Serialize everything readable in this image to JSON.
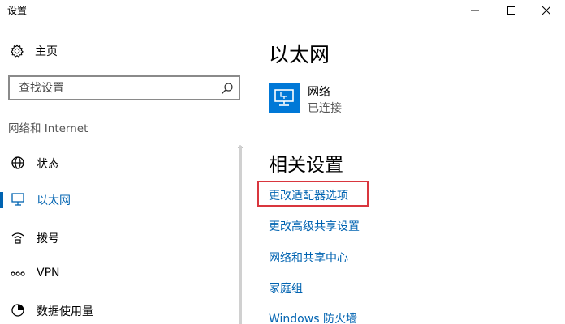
{
  "window": {
    "title": "设置",
    "controls": [
      "minimize-icon",
      "maximize-icon",
      "close-icon"
    ]
  },
  "sidebar": {
    "home_label": "主页",
    "search": {
      "placeholder": "查找设置",
      "value": ""
    },
    "section_label": "网络和 Internet",
    "items": [
      {
        "label": "状态",
        "icon": "globe-status-icon",
        "active": false
      },
      {
        "label": "以太网",
        "icon": "ethernet-icon",
        "active": true
      },
      {
        "label": "拨号",
        "icon": "dialup-icon",
        "active": false
      },
      {
        "label": "VPN",
        "icon": "vpn-icon",
        "active": false
      },
      {
        "label": "数据使用量",
        "icon": "data-usage-icon",
        "active": false
      }
    ]
  },
  "main": {
    "title": "以太网",
    "network": {
      "name": "网络",
      "status": "已连接",
      "icon": "network-computer-icon"
    },
    "related_title": "相关设置",
    "links": [
      "更改适配器选项",
      "更改高级共享设置",
      "网络和共享中心",
      "家庭组",
      "Windows 防火墙"
    ]
  },
  "colors": {
    "accent": "#0063b1",
    "tile": "#0078d7",
    "highlight": "#d9363e"
  }
}
